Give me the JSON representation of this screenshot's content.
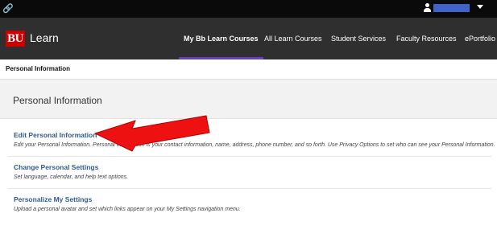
{
  "header": {
    "logo_badge": "BU",
    "logo_label": "Learn",
    "nav": [
      {
        "label": "My Bb Learn Courses",
        "active": true
      },
      {
        "label": "All Learn Courses",
        "active": false
      },
      {
        "label": "Student Services",
        "active": false
      },
      {
        "label": "Faculty Resources",
        "active": false
      },
      {
        "label": "ePortfolio",
        "active": false
      }
    ]
  },
  "topbar": {
    "left_icon": "link-icon",
    "user_icon": "user-icon",
    "user_caret": "chevron-down-icon",
    "user_name_redacted_color": "#3f63c8"
  },
  "breadcrumb": "Personal Information",
  "page": {
    "title": "Personal Information",
    "sections": [
      {
        "link": "Edit Personal Information",
        "description": "Edit your Personal Information. Personal Information is your contact information, name, address, phone number, and so forth. Use Privacy Options to set who can see your Personal Information."
      },
      {
        "link": "Change Personal Settings",
        "description": "Set language, calendar, and help text options."
      },
      {
        "link": "Personalize My Settings",
        "description": "Upload a personal avatar and set which links appear on your My Settings navigation menu."
      }
    ]
  },
  "colors": {
    "topbar": "#0a0a0a",
    "header": "#2f2f2f",
    "brand_red": "#cc0000",
    "active_underline": "#6a3fbf",
    "link": "#2f5b8f",
    "annotation_arrow": "#ee1111"
  }
}
